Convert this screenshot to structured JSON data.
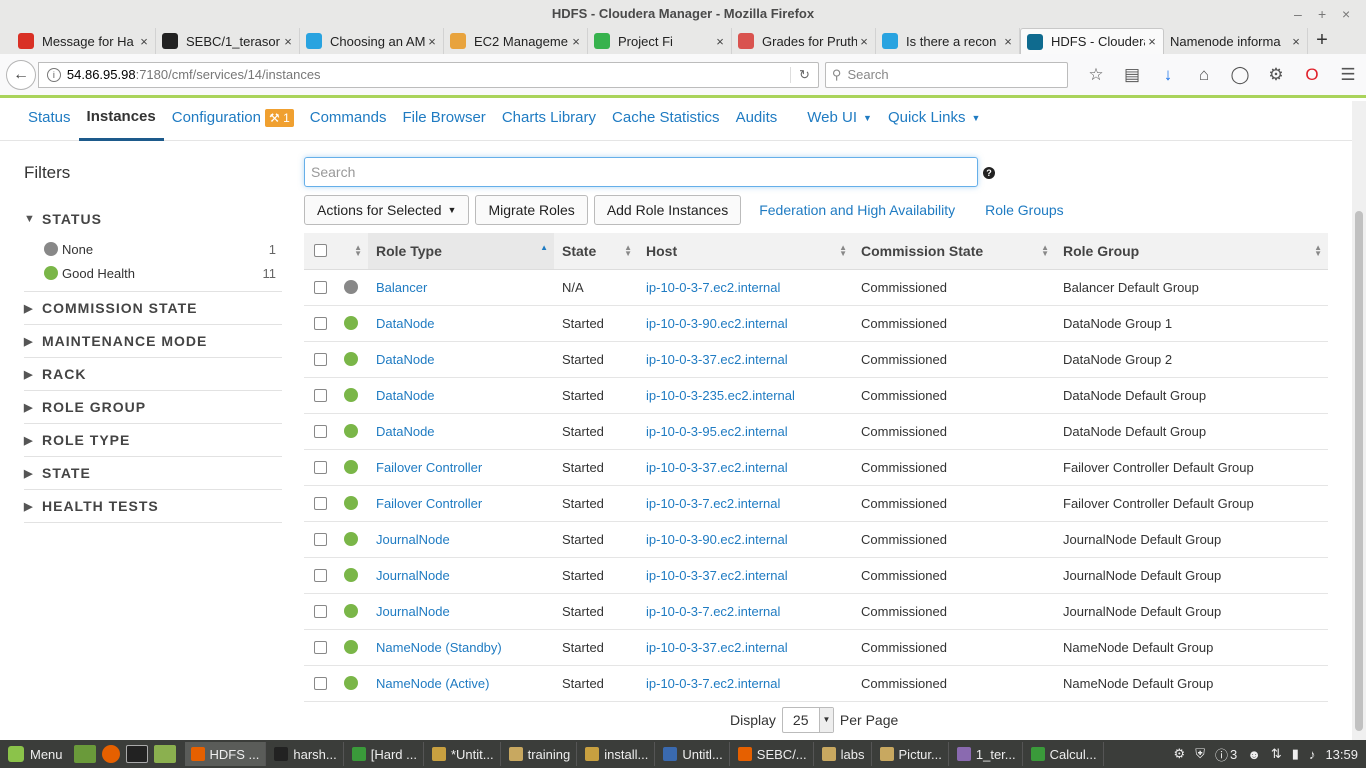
{
  "window": {
    "title": "HDFS - Cloudera Manager - Mozilla Firefox"
  },
  "tabs": [
    {
      "label": "Message for Ha",
      "icon": "gmail-icon",
      "color": "#d93025"
    },
    {
      "label": "SEBC/1_terasor",
      "icon": "github-icon",
      "color": "#222222"
    },
    {
      "label": "Choosing an AM",
      "icon": "cloudera-icon",
      "color": "#29a3e0"
    },
    {
      "label": "EC2 Manageme",
      "icon": "aws-box-icon",
      "color": "#e8a33d"
    },
    {
      "label": "Project Fi",
      "icon": "project-fi-icon",
      "color": "#37b24d"
    },
    {
      "label": "Grades for Pruth",
      "icon": "grades-icon",
      "color": "#d9534f"
    },
    {
      "label": "Is there a recon",
      "icon": "cloudera-icon",
      "color": "#29a3e0"
    },
    {
      "label": "HDFS - Cloudera",
      "icon": "cloudera-icon",
      "color": "#0f6b8f",
      "active": true
    },
    {
      "label": "Namenode informa",
      "icon": "",
      "color": ""
    }
  ],
  "nav": {
    "url_host": "54.86.95.98",
    "url_path": ":7180/cmf/services/14/instances",
    "search_placeholder": "Search"
  },
  "service_nav": {
    "status": "Status",
    "instances": "Instances",
    "configuration": "Configuration",
    "config_badge": "1",
    "commands": "Commands",
    "file_browser": "File Browser",
    "charts_library": "Charts Library",
    "cache_statistics": "Cache Statistics",
    "audits": "Audits",
    "web_ui": "Web UI",
    "quick_links": "Quick Links"
  },
  "filters": {
    "title": "Filters",
    "status_label": "STATUS",
    "status_items": [
      {
        "label": "None",
        "count": "1",
        "color": "#888888"
      },
      {
        "label": "Good Health",
        "count": "11",
        "color": "#7ab648"
      }
    ],
    "groups": [
      "COMMISSION STATE",
      "MAINTENANCE MODE",
      "RACK",
      "ROLE GROUP",
      "ROLE TYPE",
      "STATE",
      "HEALTH TESTS"
    ]
  },
  "search": {
    "placeholder": "Search"
  },
  "actions": {
    "actions_for_selected": "Actions for Selected",
    "migrate_roles": "Migrate Roles",
    "add_role_instances": "Add Role Instances",
    "federation": "Federation and High Availability",
    "role_groups": "Role Groups"
  },
  "table": {
    "headers": {
      "role_type": "Role Type",
      "state": "State",
      "host": "Host",
      "commission_state": "Commission State",
      "role_group": "Role Group"
    },
    "rows": [
      {
        "health": "#888888",
        "role_type": "Balancer",
        "state": "N/A",
        "host": "ip-10-0-3-7.ec2.internal",
        "commission": "Commissioned",
        "group": "Balancer Default Group"
      },
      {
        "health": "#7ab648",
        "role_type": "DataNode",
        "state": "Started",
        "host": "ip-10-0-3-90.ec2.internal",
        "commission": "Commissioned",
        "group": "DataNode Group 1"
      },
      {
        "health": "#7ab648",
        "role_type": "DataNode",
        "state": "Started",
        "host": "ip-10-0-3-37.ec2.internal",
        "commission": "Commissioned",
        "group": "DataNode Group 2"
      },
      {
        "health": "#7ab648",
        "role_type": "DataNode",
        "state": "Started",
        "host": "ip-10-0-3-235.ec2.internal",
        "commission": "Commissioned",
        "group": "DataNode Default Group"
      },
      {
        "health": "#7ab648",
        "role_type": "DataNode",
        "state": "Started",
        "host": "ip-10-0-3-95.ec2.internal",
        "commission": "Commissioned",
        "group": "DataNode Default Group"
      },
      {
        "health": "#7ab648",
        "role_type": "Failover Controller",
        "state": "Started",
        "host": "ip-10-0-3-37.ec2.internal",
        "commission": "Commissioned",
        "group": "Failover Controller Default Group"
      },
      {
        "health": "#7ab648",
        "role_type": "Failover Controller",
        "state": "Started",
        "host": "ip-10-0-3-7.ec2.internal",
        "commission": "Commissioned",
        "group": "Failover Controller Default Group"
      },
      {
        "health": "#7ab648",
        "role_type": "JournalNode",
        "state": "Started",
        "host": "ip-10-0-3-90.ec2.internal",
        "commission": "Commissioned",
        "group": "JournalNode Default Group"
      },
      {
        "health": "#7ab648",
        "role_type": "JournalNode",
        "state": "Started",
        "host": "ip-10-0-3-37.ec2.internal",
        "commission": "Commissioned",
        "group": "JournalNode Default Group"
      },
      {
        "health": "#7ab648",
        "role_type": "JournalNode",
        "state": "Started",
        "host": "ip-10-0-3-7.ec2.internal",
        "commission": "Commissioned",
        "group": "JournalNode Default Group"
      },
      {
        "health": "#7ab648",
        "role_type": "NameNode (Standby)",
        "state": "Started",
        "host": "ip-10-0-3-37.ec2.internal",
        "commission": "Commissioned",
        "group": "NameNode Default Group"
      },
      {
        "health": "#7ab648",
        "role_type": "NameNode (Active)",
        "state": "Started",
        "host": "ip-10-0-3-7.ec2.internal",
        "commission": "Commissioned",
        "group": "NameNode Default Group"
      }
    ]
  },
  "pager": {
    "display": "Display",
    "per_page_value": "25",
    "per_page": "Per Page"
  },
  "taskbar": {
    "menu": "Menu",
    "windows": [
      "HDFS ...",
      "harsh...",
      "[Hard ...",
      "*Untit...",
      "training",
      "install...",
      "Untitl...",
      "SEBC/...",
      "labs",
      "Pictur...",
      "1_ter...",
      "Calcul..."
    ],
    "tray_count": "3",
    "clock": "13:59"
  }
}
